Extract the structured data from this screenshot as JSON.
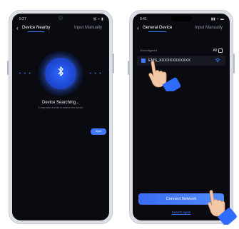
{
  "left_phone": {
    "status": {
      "time": "9:27",
      "icons": "᯾ ⌁ ▮"
    },
    "nav": {
      "back": "‹",
      "tab_active": "Device Nearby",
      "tab_other": "Input Manually"
    },
    "search": {
      "title": "Device Searching...",
      "subtitle": "It may take a while to search the device"
    },
    "mini_pill": "Input"
  },
  "right_phone": {
    "status": {
      "time": "9:41",
      "icons": "▮▮ ⌁ ▬"
    },
    "nav": {
      "back": "‹",
      "tab_active": "General Device",
      "tab_other": "Input Manually"
    },
    "section": {
      "label": "Unconfigured",
      "all_label": "All"
    },
    "device": {
      "name": "EMS_XXXXXXXXXXXX"
    },
    "connect_button": "Connect Network",
    "search_again": "Search again"
  },
  "colors": {
    "accent": "#3e7bff",
    "screen_bg": "#0a0b10",
    "hand_sleeve": "#2f6bff"
  }
}
